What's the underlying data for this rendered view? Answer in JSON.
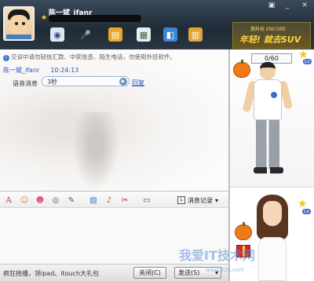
{
  "header": {
    "nickname": "陈一斌_ifanr",
    "toolbar": [
      "video-call-icon",
      "voice-call-icon",
      "send-file-icon",
      "remote-assist-icon",
      "app-share-icon",
      "more-apps-icon"
    ],
    "window_controls": [
      "menu",
      "minimize",
      "close"
    ]
  },
  "ad_banner": {
    "brand": "惠科技 ENCORE",
    "slogan": "年轻! 就去SUV"
  },
  "chat": {
    "notice": "交谈中请勿轻信汇款、中奖信息、陌生电话，勿使用外挂软件。",
    "message": {
      "sender": "陈一斌_ifanr",
      "time": "10:24:13",
      "voice_label": "语音消息",
      "voice_duration": "3秒",
      "replay_link": "回复"
    }
  },
  "side_panel": {
    "counter": "0/60"
  },
  "input_toolbar": {
    "buttons": [
      "font-icon",
      "emoticon-icon",
      "magic-emoticon-icon",
      "shake-icon",
      "doodle-icon",
      "image-icon",
      "music-icon",
      "screenshot-icon",
      "schedule-icon"
    ],
    "history_label": "消息记录"
  },
  "bottom": {
    "promo": "疯狂抢播，领ipad、itouch大礼包",
    "close_label": "关闭(C)",
    "send_label": "发送(S)"
  },
  "watermark": {
    "text": "我爱IT技术网",
    "url": "www.52ij.com"
  },
  "colors": {
    "header_bg": "#2a3642",
    "link_blue": "#2a55b4",
    "ad_gold": "#ffd34a"
  }
}
